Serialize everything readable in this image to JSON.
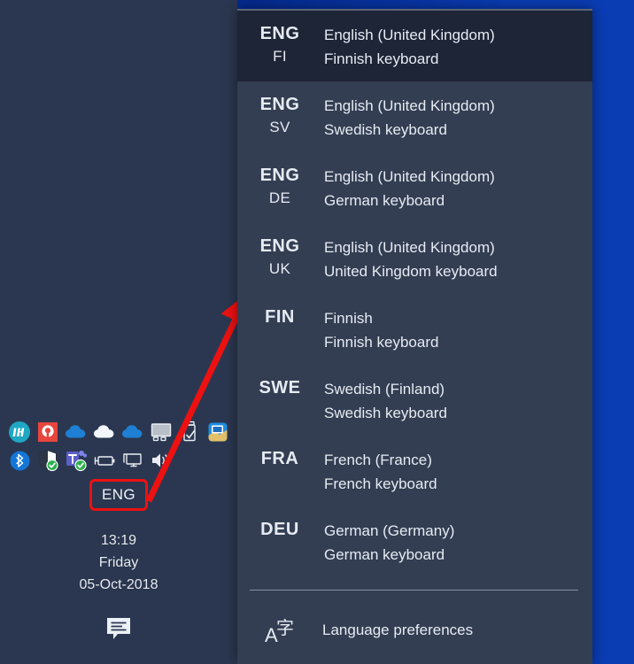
{
  "desktop": {
    "wallpaper_color": "#0a3cb4",
    "taskbar_color": "#2b3750"
  },
  "taskbar": {
    "tray_rows": [
      [
        {
          "name": "hp-icon",
          "label": "HP"
        },
        {
          "name": "printer-assistant-icon",
          "label": "p"
        },
        {
          "name": "onedrive-business-icon",
          "label": "OneDrive"
        },
        {
          "name": "onedrive-personal-icon",
          "label": "OneDrive"
        },
        {
          "name": "onedrive-second-icon",
          "label": "OneDrive"
        },
        {
          "name": "display-monitor-icon",
          "label": "Display"
        },
        {
          "name": "safely-remove-hardware-icon",
          "label": "Safely Remove Hardware"
        },
        {
          "name": "remote-desktop-icon",
          "label": "Remote Desktop"
        }
      ],
      [
        {
          "name": "bluetooth-icon",
          "label": "Bluetooth"
        },
        {
          "name": "windows-defender-icon",
          "label": "Windows Defender"
        },
        {
          "name": "microsoft-teams-icon",
          "label": "Microsoft Teams"
        },
        {
          "name": "battery-icon",
          "label": "Battery"
        },
        {
          "name": "network-icon",
          "label": "Network"
        },
        {
          "name": "volume-icon",
          "label": "Volume"
        }
      ]
    ],
    "language_button": {
      "label": "ENG",
      "highlight_color": "#ee1111"
    },
    "clock": {
      "time": "13:19",
      "weekday": "Friday",
      "date": "05-Oct-2018"
    },
    "action_center": {
      "icon": "speech-bubble-icon",
      "label": "Action Center"
    }
  },
  "flyout": {
    "background_color": "#333e52",
    "selected_color": "#1e2536",
    "items": [
      {
        "abbr": "ENG",
        "sub": "FI",
        "name": "English (United Kingdom)",
        "layout": "Finnish keyboard",
        "selected": true
      },
      {
        "abbr": "ENG",
        "sub": "SV",
        "name": "English (United Kingdom)",
        "layout": "Swedish keyboard",
        "selected": false
      },
      {
        "abbr": "ENG",
        "sub": "DE",
        "name": "English (United Kingdom)",
        "layout": "German keyboard",
        "selected": false
      },
      {
        "abbr": "ENG",
        "sub": "UK",
        "name": "English (United Kingdom)",
        "layout": "United Kingdom keyboard",
        "selected": false
      },
      {
        "abbr": "FIN",
        "sub": "",
        "name": "Finnish",
        "layout": "Finnish keyboard",
        "selected": false
      },
      {
        "abbr": "SWE",
        "sub": "",
        "name": "Swedish (Finland)",
        "layout": "Swedish keyboard",
        "selected": false
      },
      {
        "abbr": "FRA",
        "sub": "",
        "name": "French (France)",
        "layout": "French keyboard",
        "selected": false
      },
      {
        "abbr": "DEU",
        "sub": "",
        "name": "German (Germany)",
        "layout": "German keyboard",
        "selected": false
      }
    ],
    "preferences": {
      "icon": "language-a-zi-icon",
      "label": "Language preferences"
    }
  },
  "annotation": {
    "arrow_color": "#ee1111",
    "type": "arrow-pointing-to-flyout"
  }
}
